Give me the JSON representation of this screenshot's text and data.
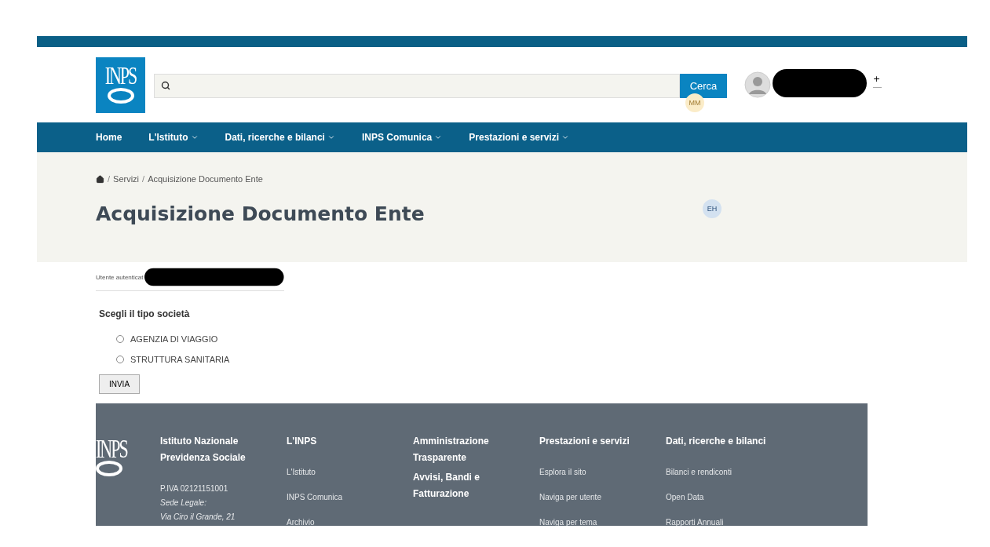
{
  "header": {
    "logo": "INPS",
    "search": {
      "button": "Cerca"
    },
    "cursor_badge": "MM",
    "account_plus": "+"
  },
  "nav": [
    {
      "label": "Home",
      "has_menu": false
    },
    {
      "label": "L'Istituto",
      "has_menu": true
    },
    {
      "label": "Dati, ricerche e bilanci",
      "has_menu": true
    },
    {
      "label": "INPS Comunica",
      "has_menu": true
    },
    {
      "label": "Prestazioni e servizi",
      "has_menu": true
    }
  ],
  "breadcrumb": [
    {
      "kind": "separator",
      "text": "/"
    },
    {
      "kind": "link",
      "text": "Servizi"
    },
    {
      "kind": "separator",
      "text": "/"
    },
    {
      "kind": "link",
      "text": "Acquisizione Documento Ente"
    }
  ],
  "page_title": "Acquisizione Documento Ente",
  "title_badge": "EH",
  "user_line": "Utente autenticat",
  "form": {
    "legend": "Scegli il tipo società",
    "options": [
      {
        "label": "AGENZIA DI VIAGGIO",
        "selected": false
      },
      {
        "label": "STRUTTURA SANITARIA",
        "selected": false
      }
    ],
    "submit": "INVIA"
  },
  "footer": {
    "logo": "INPS",
    "columns": [
      {
        "headings": [
          "Istituto Nazionale Previdenza Sociale"
        ],
        "lines": [
          {
            "text": "P.IVA 02121151001",
            "italic": false
          },
          {
            "text": "Sede Legale:",
            "italic": true
          },
          {
            "text": "Via Ciro il Grande, 21",
            "italic": true
          }
        ]
      },
      {
        "headings": [
          "L'INPS"
        ],
        "lines": [
          {
            "text": "L'Istituto",
            "italic": false
          },
          {
            "text": "INPS Comunica",
            "italic": false
          },
          {
            "text": "Archivio",
            "italic": false
          }
        ]
      },
      {
        "headings": [
          "Amministrazione Trasparente",
          "Avvisi, Bandi e Fatturazione"
        ]
      },
      {
        "headings": [
          "Prestazioni e servizi"
        ],
        "lines": [
          {
            "text": "Esplora il sito",
            "italic": false
          },
          {
            "text": "Naviga per utente",
            "italic": false
          },
          {
            "text": "Naviga per tema",
            "italic": false
          }
        ]
      },
      {
        "headings": [
          "Dati, ricerche e bilanci"
        ],
        "lines": [
          {
            "text": "Bilanci e rendiconti",
            "italic": false
          },
          {
            "text": "Open Data",
            "italic": false
          },
          {
            "text": "Rapporti Annuali",
            "italic": false
          }
        ]
      }
    ]
  }
}
